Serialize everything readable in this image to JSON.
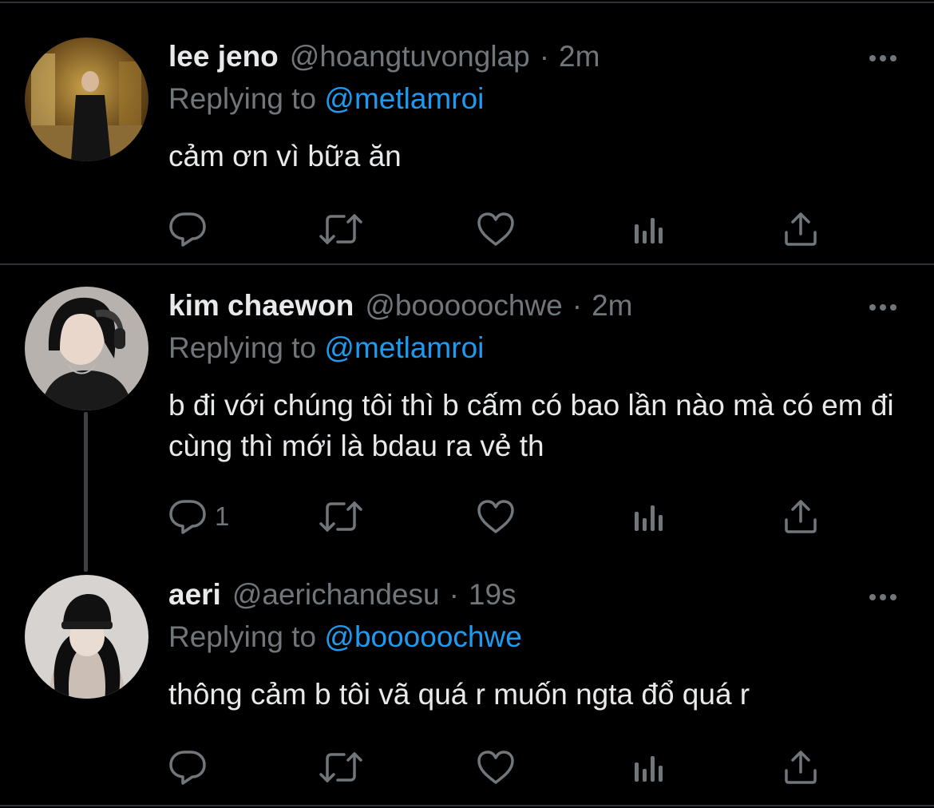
{
  "tweets": [
    {
      "name": "lee jeno",
      "handle": "@hoangtuvonglap",
      "separator": "·",
      "time": "2m",
      "replying_prefix": "Replying to",
      "replying_to": "@metlamroi",
      "text": "cảm ơn vì bữa ăn",
      "reply_count": ""
    },
    {
      "name": "kim chaewon",
      "handle": "@booooochwe",
      "separator": "·",
      "time": "2m",
      "replying_prefix": "Replying to",
      "replying_to": "@metlamroi",
      "text": "b đi với chúng tôi thì b cấm có bao lần nào mà có em đi cùng thì mới là bdau ra vẻ th",
      "reply_count": "1"
    },
    {
      "name": "aeri",
      "handle": "@aerichandesu",
      "separator": "·",
      "time": "19s",
      "replying_prefix": "Replying to",
      "replying_to": "@booooochwe",
      "text": "thông cảm b tôi vã quá r muốn ngta đổ quá r",
      "reply_count": ""
    }
  ],
  "colors": {
    "background": "#000000",
    "text": "#e7e9ea",
    "muted": "#71767b",
    "link": "#1d9bf0",
    "divider": "#2f3336"
  },
  "icons": [
    "reply-icon",
    "retweet-icon",
    "like-icon",
    "analytics-icon",
    "share-icon",
    "more-icon"
  ]
}
